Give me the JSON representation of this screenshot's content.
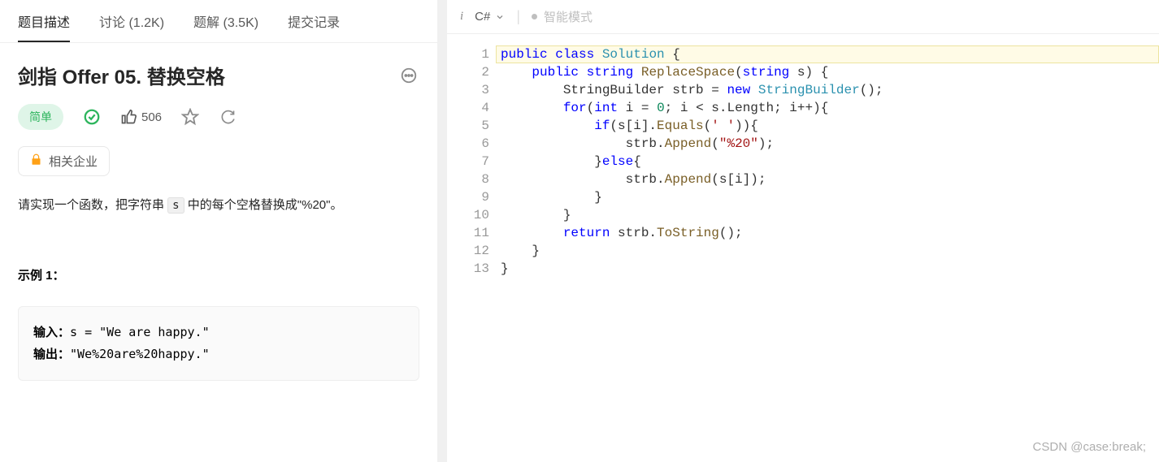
{
  "tabs": {
    "description": "题目描述",
    "discuss": "讨论 (1.2K)",
    "solution": "题解 (3.5K)",
    "submissions": "提交记录"
  },
  "problem": {
    "title": "剑指 Offer 05. 替换空格",
    "difficulty": "简单",
    "likes": "506",
    "related_companies": "相关企业",
    "desc_part1": "请实现一个函数，把字符串 ",
    "desc_code": "s",
    "desc_part2": " 中的每个空格替换成\"%20\"。",
    "example_label": "示例 1：",
    "input_label": "输入：",
    "input_value": "s = \"We are happy.\"",
    "output_label": "输出：",
    "output_value": "\"We%20are%20happy.\""
  },
  "editor": {
    "language": "C#",
    "smart_mode": "智能模式",
    "line_numbers": [
      "1",
      "2",
      "3",
      "4",
      "5",
      "6",
      "7",
      "8",
      "9",
      "10",
      "11",
      "12",
      "13"
    ],
    "code": {
      "tokens": [
        [
          {
            "t": "public ",
            "c": "kw-blue"
          },
          {
            "t": "class ",
            "c": "kw-blue"
          },
          {
            "t": "Solution",
            "c": "kw-teal"
          },
          {
            "t": " {",
            "c": ""
          }
        ],
        [
          {
            "t": "    ",
            "c": ""
          },
          {
            "t": "public ",
            "c": "kw-blue"
          },
          {
            "t": "string ",
            "c": "kw-blue"
          },
          {
            "t": "ReplaceSpace",
            "c": "fn-brown"
          },
          {
            "t": "(",
            "c": ""
          },
          {
            "t": "string",
            "c": "kw-blue"
          },
          {
            "t": " s) {",
            "c": ""
          }
        ],
        [
          {
            "t": "        StringBuilder strb = ",
            "c": ""
          },
          {
            "t": "new",
            "c": "kw-blue"
          },
          {
            "t": " ",
            "c": ""
          },
          {
            "t": "StringBuilder",
            "c": "kw-teal"
          },
          {
            "t": "();",
            "c": ""
          }
        ],
        [
          {
            "t": "        ",
            "c": ""
          },
          {
            "t": "for",
            "c": "kw-blue"
          },
          {
            "t": "(",
            "c": ""
          },
          {
            "t": "int",
            "c": "kw-blue"
          },
          {
            "t": " i = ",
            "c": ""
          },
          {
            "t": "0",
            "c": "num"
          },
          {
            "t": "; i < s.Length; i++){",
            "c": ""
          }
        ],
        [
          {
            "t": "            ",
            "c": ""
          },
          {
            "t": "if",
            "c": "kw-blue"
          },
          {
            "t": "(s[i].",
            "c": ""
          },
          {
            "t": "Equals",
            "c": "fn-brown"
          },
          {
            "t": "(",
            "c": ""
          },
          {
            "t": "' '",
            "c": "ch"
          },
          {
            "t": ")){",
            "c": ""
          }
        ],
        [
          {
            "t": "                strb.",
            "c": ""
          },
          {
            "t": "Append",
            "c": "fn-brown"
          },
          {
            "t": "(",
            "c": ""
          },
          {
            "t": "\"%20\"",
            "c": "str"
          },
          {
            "t": ");",
            "c": ""
          }
        ],
        [
          {
            "t": "            }",
            "c": ""
          },
          {
            "t": "else",
            "c": "kw-blue"
          },
          {
            "t": "{",
            "c": ""
          }
        ],
        [
          {
            "t": "                strb.",
            "c": ""
          },
          {
            "t": "Append",
            "c": "fn-brown"
          },
          {
            "t": "(s[i]);",
            "c": ""
          }
        ],
        [
          {
            "t": "            }",
            "c": ""
          }
        ],
        [
          {
            "t": "        }",
            "c": ""
          }
        ],
        [
          {
            "t": "        ",
            "c": ""
          },
          {
            "t": "return",
            "c": "kw-blue"
          },
          {
            "t": " strb.",
            "c": ""
          },
          {
            "t": "ToString",
            "c": "fn-brown"
          },
          {
            "t": "();",
            "c": ""
          }
        ],
        [
          {
            "t": "    }",
            "c": ""
          }
        ],
        [
          {
            "t": "}",
            "c": ""
          }
        ]
      ]
    }
  },
  "watermark": "CSDN @case:break;"
}
